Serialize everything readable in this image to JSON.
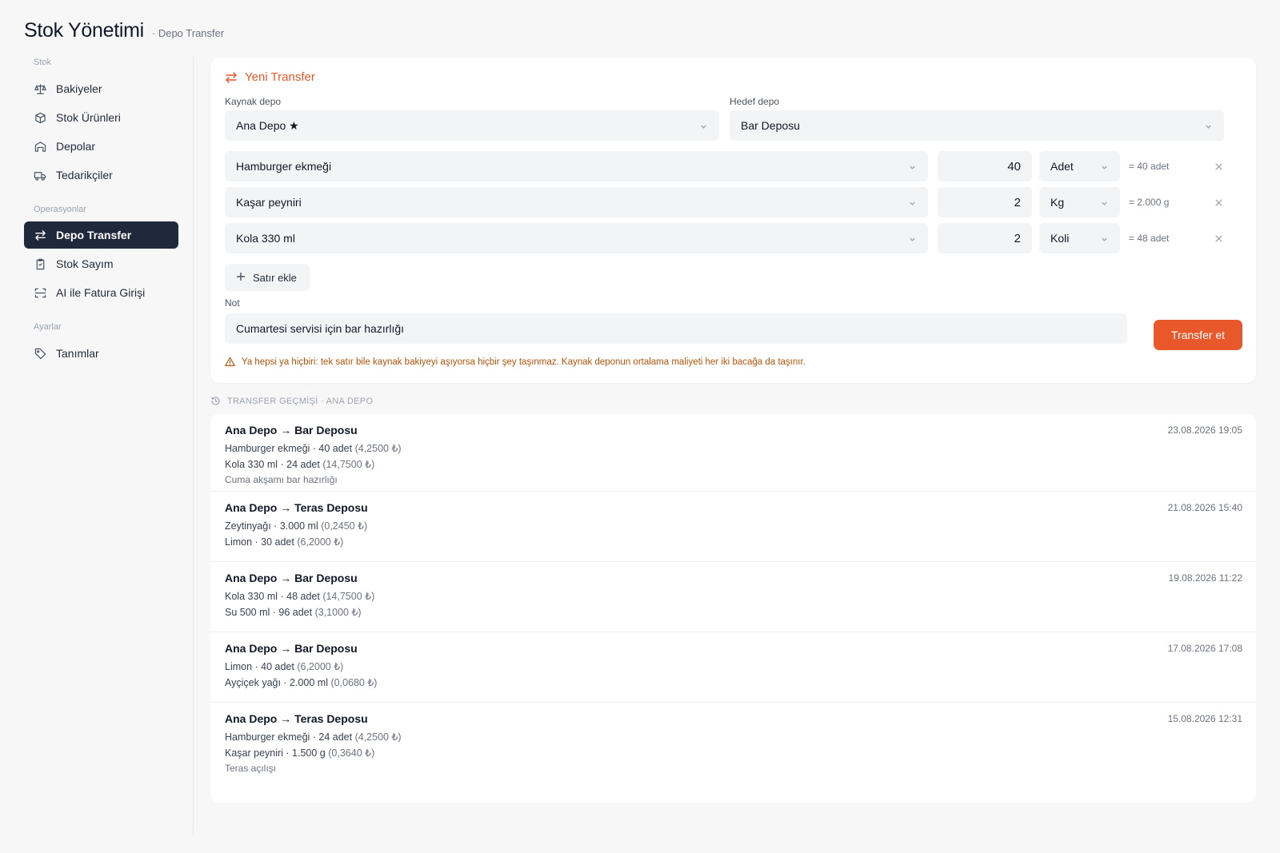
{
  "header": {
    "title": "Stok Yönetimi",
    "subtitle": "· Depo Transfer"
  },
  "sidebar": {
    "sections": [
      {
        "label": "Stok",
        "items": [
          {
            "label": "Bakiyeler",
            "icon": "scale-icon"
          },
          {
            "label": "Stok Ürünleri",
            "icon": "box-icon"
          },
          {
            "label": "Depolar",
            "icon": "warehouse-icon"
          },
          {
            "label": "Tedarikçiler",
            "icon": "truck-icon"
          }
        ]
      },
      {
        "label": "Operasyonlar",
        "items": [
          {
            "label": "Depo Transfer",
            "icon": "transfer-icon",
            "active": true
          },
          {
            "label": "Stok Sayım",
            "icon": "clipboard-icon"
          },
          {
            "label": "AI ile Fatura Girişi",
            "icon": "scan-icon"
          }
        ]
      },
      {
        "label": "Ayarlar",
        "items": [
          {
            "label": "Tanımlar",
            "icon": "tag-icon"
          }
        ]
      }
    ]
  },
  "form": {
    "title": "Yeni Transfer",
    "source_label": "Kaynak depo",
    "source_value": "Ana Depo ★",
    "target_label": "Hedef depo",
    "target_value": "Bar Deposu",
    "lines": [
      {
        "product": "Hamburger ekmeği",
        "qty": "40",
        "unit": "Adet",
        "conversion": "= 40 adet"
      },
      {
        "product": "Kaşar peyniri",
        "qty": "2",
        "unit": "Kg",
        "conversion": "= 2.000 g"
      },
      {
        "product": "Kola 330 ml",
        "qty": "2",
        "unit": "Koli",
        "conversion": "= 48 adet"
      }
    ],
    "add_line_label": "Satır ekle",
    "note_label": "Not",
    "note_value": "Cumartesi servisi için bar hazırlığı",
    "submit_label": "Transfer et",
    "warning": "Ya hepsi ya hiçbiri: tek satır bile kaynak bakiyeyi aşıyorsa hiçbir şey taşınmaz. Kaynak deponun ortalama maliyeti her iki bacağa da taşınır."
  },
  "history": {
    "title": "TRANSFER GEÇMİŞİ · ANA DEPO",
    "entries": [
      {
        "route": "Ana Depo → Bar Deposu",
        "date": "23.08.2026 19:05",
        "lines": [
          {
            "text": "Hamburger ekmeği · 40 adet",
            "cost": "(4,2500 ₺)"
          },
          {
            "text": "Kola 330 ml · 24 adet",
            "cost": "(14,7500 ₺)"
          }
        ],
        "note": "Cuma akşamı bar hazırlığı"
      },
      {
        "route": "Ana Depo → Teras Deposu",
        "date": "21.08.2026 15:40",
        "lines": [
          {
            "text": "Zeytinyağı · 3.000 ml",
            "cost": "(0,2450 ₺)"
          },
          {
            "text": "Limon · 30 adet",
            "cost": "(6,2000 ₺)"
          }
        ],
        "note": ""
      },
      {
        "route": "Ana Depo → Bar Deposu",
        "date": "19.08.2026 11:22",
        "lines": [
          {
            "text": "Kola 330 ml · 48 adet",
            "cost": "(14,7500 ₺)"
          },
          {
            "text": "Su 500 ml · 96 adet",
            "cost": "(3,1000 ₺)"
          }
        ],
        "note": ""
      },
      {
        "route": "Ana Depo → Bar Deposu",
        "date": "17.08.2026 17:08",
        "lines": [
          {
            "text": "Limon · 40 adet",
            "cost": "(6,2000 ₺)"
          },
          {
            "text": "Ayçiçek yağı · 2.000 ml",
            "cost": "(0,0680 ₺)"
          }
        ],
        "note": ""
      },
      {
        "route": "Ana Depo → Teras Deposu",
        "date": "15.08.2026 12:31",
        "lines": [
          {
            "text": "Hamburger ekmeği · 24 adet",
            "cost": "(4,2500 ₺)"
          },
          {
            "text": "Kaşar peyniri · 1.500 g",
            "cost": "(0,3640 ₺)"
          }
        ],
        "note": "Teras açılışı"
      }
    ]
  },
  "colors": {
    "accent": "#e8582a",
    "active_nav": "#1e293b",
    "warning": "#b45309"
  }
}
